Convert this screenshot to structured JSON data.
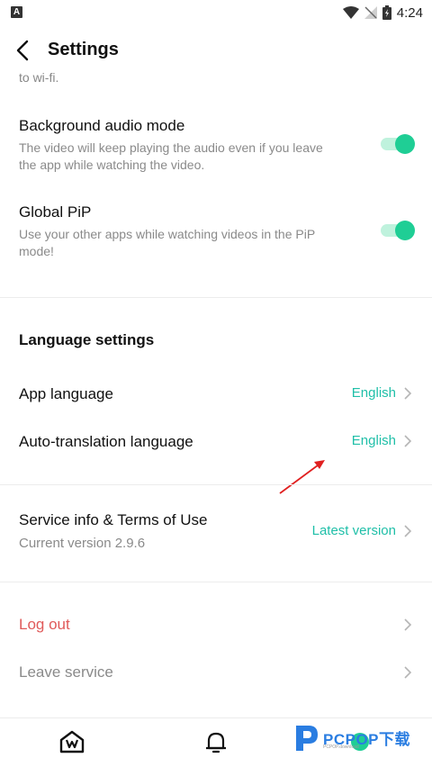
{
  "status_bar": {
    "time": "4:24"
  },
  "header": {
    "title": "Settings"
  },
  "cut_off_text": "to wi-fi.",
  "settings": {
    "background_audio": {
      "title": "Background audio mode",
      "description": "The video will keep playing the audio even if you leave the app while watching the video.",
      "enabled": true
    },
    "global_pip": {
      "title": "Global PiP",
      "description": "Use your other apps while watching videos in the PiP mode!",
      "enabled": true
    }
  },
  "language_settings": {
    "heading": "Language settings",
    "app_language": {
      "label": "App language",
      "value": "English"
    },
    "auto_translation": {
      "label": "Auto-translation language",
      "value": "English"
    }
  },
  "service": {
    "title": "Service info & Terms of Use",
    "current_version": "Current version 2.9.6",
    "value": "Latest version"
  },
  "account": {
    "logout": "Log out",
    "leave": "Leave service"
  },
  "watermark": {
    "brand": "PCPOP下载",
    "small": "PCPOP.download"
  },
  "colors": {
    "accent": "#1fce95",
    "accent_text": "#1fbfa8",
    "logout": "#e05a5a",
    "muted": "#8a8a8a"
  },
  "nav_icons": [
    "home-w-icon",
    "bell-icon",
    "profile-icon"
  ]
}
